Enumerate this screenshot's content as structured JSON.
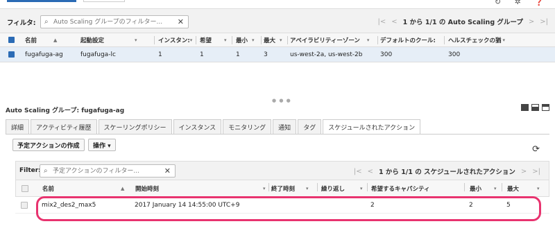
{
  "toolbar_icons": [
    "refresh-icon",
    "settings-icon",
    "help-icon"
  ],
  "top_filter": {
    "label": "フィルタ:",
    "placeholder": "Auto Scaling グループのフィルター...",
    "pager_text": "1 から 1/1 の Auto Scaling グループ"
  },
  "group_table": {
    "headers": [
      "名前",
      "起動設定",
      "インスタン:",
      "希望",
      "最小",
      "最大",
      "アベイラビリティーゾーン",
      "デフォルトのクール:",
      "ヘルスチェックの猶"
    ],
    "rows": [
      [
        "fugafuga-ag",
        "fugafuga-lc",
        "1",
        "1",
        "1",
        "3",
        "us-west-2a, us-west-2b",
        "300",
        "300"
      ]
    ]
  },
  "detail": {
    "title": "Auto Scaling グループ: fugafuga-ag",
    "tabs": [
      "詳細",
      "アクティビティ履歴",
      "スケーリングポリシー",
      "インスタンス",
      "モニタリング",
      "通知",
      "タグ",
      "スケジュールされたアクション"
    ],
    "active_tab": 7,
    "create_button": "予定アクションの作成",
    "actions_button": "操作 ▾"
  },
  "sched_filter": {
    "label": "Filter:",
    "placeholder": "予定アクションのフィルター...",
    "pager_text": "1 から 1/1 の スケジュールされたアクション"
  },
  "sched_table": {
    "headers": [
      "名前",
      "開始時刻",
      "終了時刻",
      "繰り返し",
      "希望するキャパシティ",
      "最小",
      "最大"
    ],
    "rows": [
      [
        "mix2_des2_max5",
        "2017 January 14 14:55:00 UTC+9",
        "",
        "",
        "2",
        "2",
        "5"
      ]
    ]
  },
  "colors": {
    "highlight": "#e8336f",
    "selected_row": "#e6eef7",
    "accent": "#2b6bb5"
  }
}
